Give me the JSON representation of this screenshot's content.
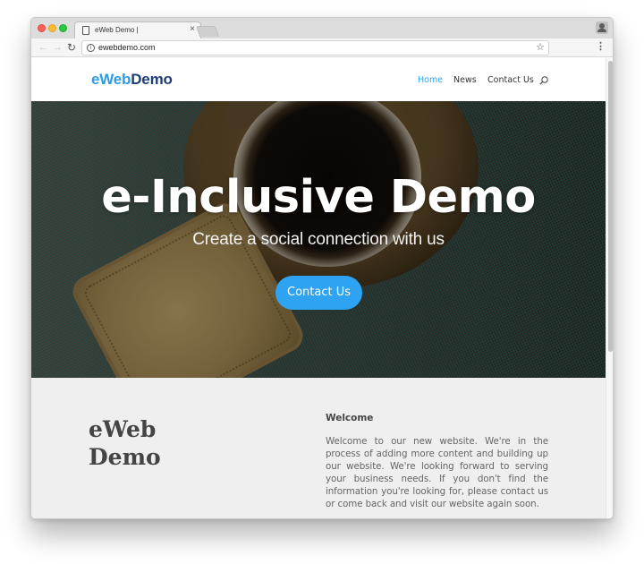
{
  "browser": {
    "tab_title": "eWeb Demo |",
    "tab_close": "×",
    "url": "ewebdemo.com",
    "icons": {
      "back": "back-arrow-icon",
      "forward": "forward-arrow-icon",
      "reload": "reload-icon",
      "info": "info-icon",
      "bookmark": "star-icon",
      "menu": "kebab-menu-icon",
      "profile": "profile-icon"
    },
    "glyphs": {
      "back": "←",
      "forward": "→",
      "reload": "↻",
      "info": "i",
      "star": "☆",
      "menu": "⋮"
    }
  },
  "site": {
    "logo": {
      "part1": "eWeb",
      "part2": "Demo",
      "color1": "#2c9be8",
      "color2": "#1e3d7a"
    },
    "nav": [
      {
        "label": "Home",
        "active": true
      },
      {
        "label": "News",
        "active": false
      },
      {
        "label": "Contact Us",
        "active": false
      }
    ],
    "accent": "#2ea3f2"
  },
  "hero": {
    "title": "e-Inclusive Demo",
    "subtitle": "Create a social connection with us",
    "cta_label": "Contact Us"
  },
  "content": {
    "title": "eWeb Demo",
    "welcome_heading": "Welcome",
    "welcome_body": "Welcome to our new website. We're in the process of adding more content and building up our website. We're looking forward to serving your business needs. If you don't find the information you're looking for, please contact us or come back and visit our website again soon."
  }
}
